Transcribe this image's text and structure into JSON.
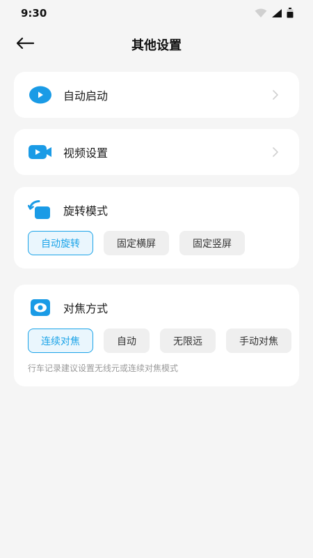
{
  "status_bar": {
    "time": "9:30",
    "icons": [
      "wifi-icon",
      "signal-icon",
      "battery-icon"
    ]
  },
  "header": {
    "back_icon": "arrow-left-icon",
    "title": "其他设置"
  },
  "colors": {
    "accent": "#1aa3e8",
    "accent_bg": "#eaf6fd",
    "icon_blue": "#1a9be6",
    "background": "#f5f5f5",
    "card": "#ffffff"
  },
  "settings": {
    "auto_start": {
      "label": "自动启动",
      "icon": "play-circle-icon"
    },
    "video": {
      "label": "视频设置",
      "icon": "video-camera-icon"
    },
    "rotation": {
      "label": "旋转模式",
      "icon": "rotate-screen-icon",
      "options": [
        "自动旋转",
        "固定横屏",
        "固定竖屏"
      ],
      "selected": "自动旋转"
    },
    "focus": {
      "label": "对焦方式",
      "icon": "focus-eye-icon",
      "options": [
        "连续对焦",
        "自动",
        "无限远",
        "手动对焦"
      ],
      "selected": "连续对焦",
      "hint": "行车记录建议设置无线元或连续对焦模式"
    }
  }
}
